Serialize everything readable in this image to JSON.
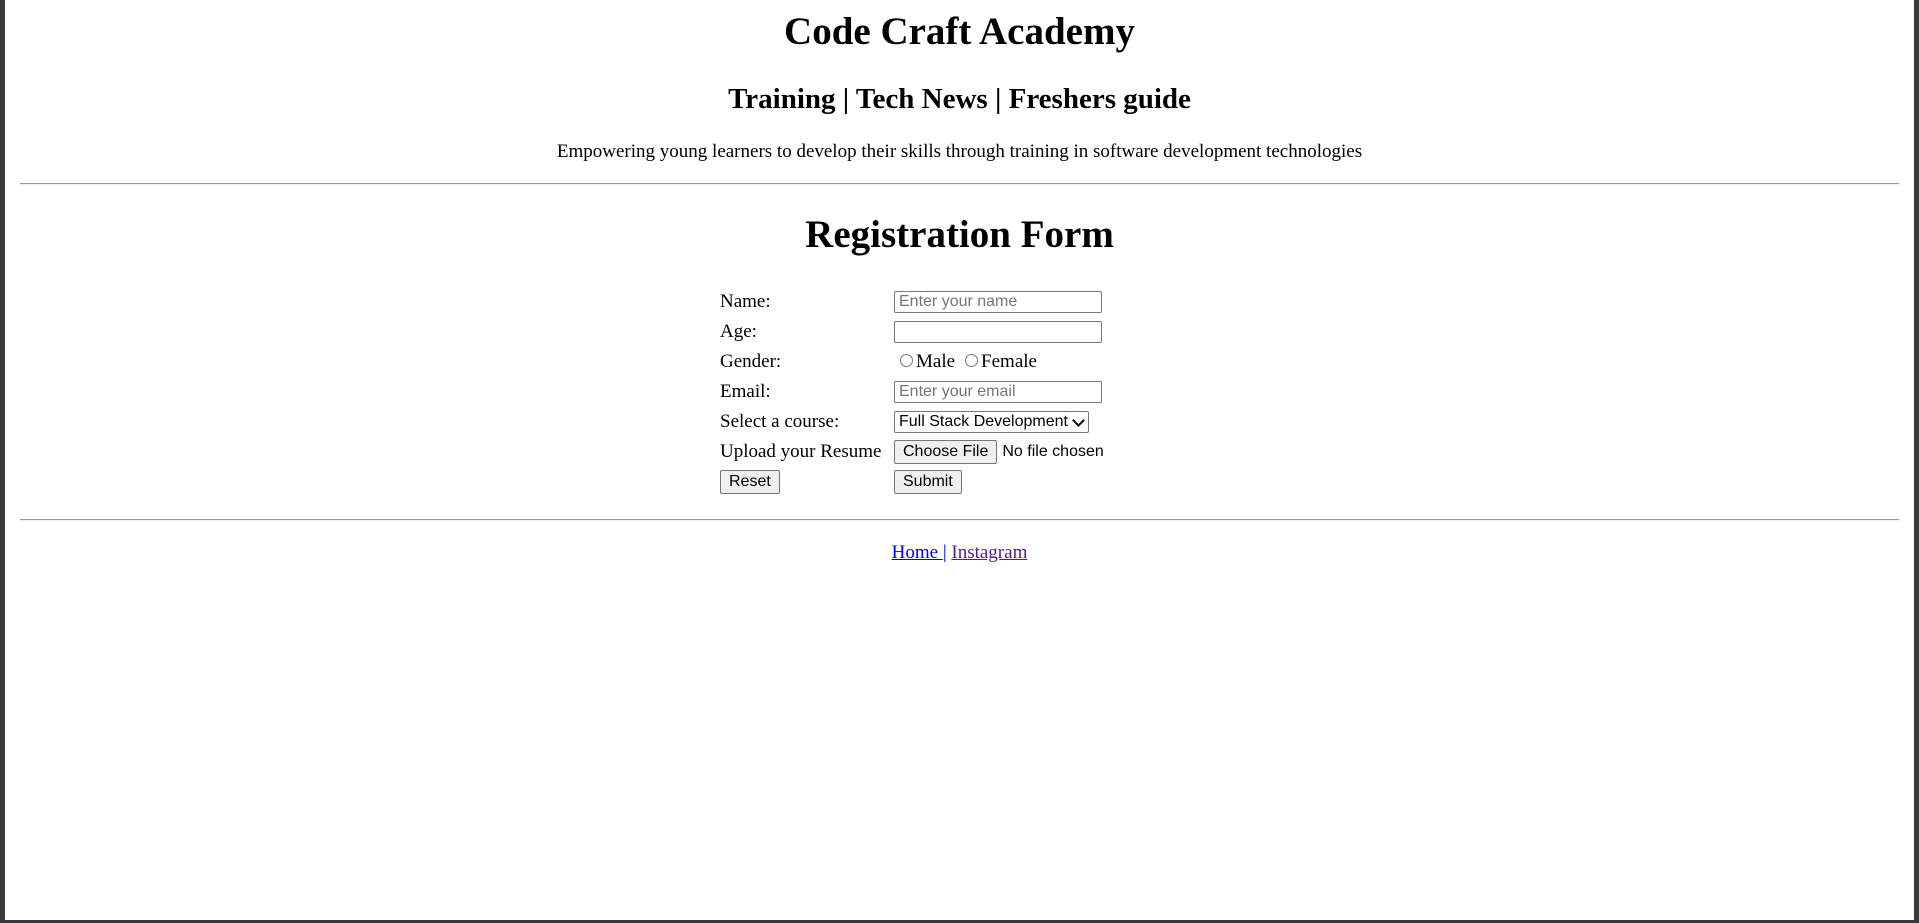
{
  "header": {
    "title": "Code Craft Academy",
    "nav_line": "Training | Tech News | Freshers guide",
    "tagline": "Empowering young learners to develop their skills through training in software development technologies"
  },
  "form": {
    "title": "Registration Form",
    "name_label": "Name:",
    "name_placeholder": "Enter your name",
    "age_label": "Age:",
    "gender_label": "Gender:",
    "gender_options": [
      "Male",
      "Female"
    ],
    "email_label": "Email:",
    "email_placeholder": "Enter your email",
    "course_label": "Select a course:",
    "course_selected": "Full Stack Development",
    "resume_label": "Upload your Resume",
    "choose_file_label": "Choose File",
    "file_status": "No file chosen",
    "reset_label": "Reset",
    "submit_label": "Submit"
  },
  "footer": {
    "home_label": "Home ",
    "separator": "|",
    "instagram_label": "Instagram"
  },
  "colors": {
    "link_unvisited": "#0000ee",
    "link_visited": "#551a8b"
  }
}
